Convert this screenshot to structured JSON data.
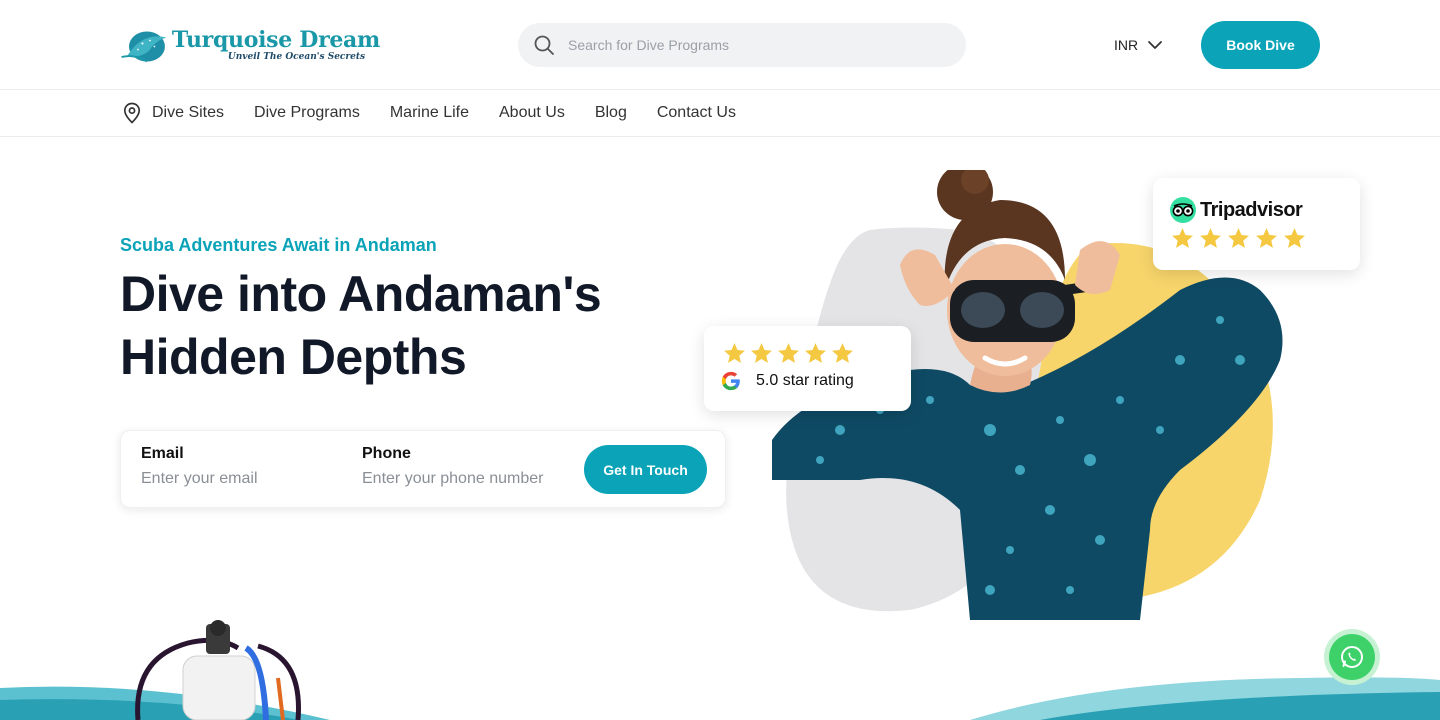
{
  "header": {
    "logo_name": "Turquoise Dream",
    "logo_tagline": "Unveil The Ocean's Secrets",
    "search_placeholder": "Search for Dive Programs",
    "currency": "INR",
    "book_label": "Book Dive"
  },
  "nav": {
    "items": [
      {
        "label": "Dive Sites",
        "icon": "location-pin-icon"
      },
      {
        "label": "Dive Programs"
      },
      {
        "label": "Marine Life"
      },
      {
        "label": "About Us"
      },
      {
        "label": "Blog"
      },
      {
        "label": "Contact Us"
      }
    ]
  },
  "hero": {
    "subtitle": "Scuba Adventures Await in Andaman",
    "title_line1": "Dive into Andaman's",
    "title_line2": "Hidden Depths"
  },
  "contact_form": {
    "email_label": "Email",
    "email_placeholder": "Enter your email",
    "phone_label": "Phone",
    "phone_placeholder": "Enter your phone number",
    "submit_label": "Get In Touch"
  },
  "badges": {
    "google": {
      "rating_text": "5.0 star rating",
      "stars": 5,
      "icon": "google-icon"
    },
    "tripadvisor": {
      "brand": "Tripadvisor",
      "stars": 5,
      "icon": "tripadvisor-owl-icon"
    }
  },
  "floating": {
    "whatsapp_icon": "whatsapp-icon"
  },
  "colors": {
    "accent": "#0aa3b8",
    "heading": "#111827",
    "star": "#f5c842",
    "blob_gray": "#e4e4e6",
    "blob_yellow": "#f7d56b",
    "whatsapp": "#3ed16a"
  }
}
